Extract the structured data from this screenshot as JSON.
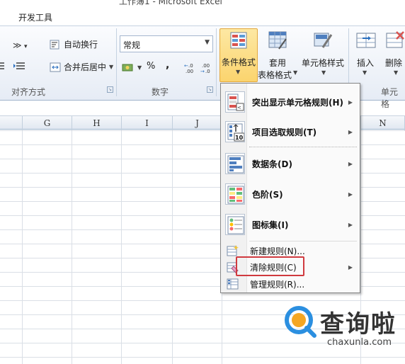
{
  "window": {
    "title": "工作簿1 - Microsoft Excel"
  },
  "tabs": {
    "developer": "开发工具"
  },
  "ribbon": {
    "alignment": {
      "label": "对齐方式",
      "wrap_text": "自动换行",
      "merge_center": "合并后居中"
    },
    "number": {
      "label": "数字",
      "format_value": "常规",
      "percent": "%",
      "comma": ",",
      "increase_decimal": ".00",
      "decrease_decimal": ".00"
    },
    "styles": {
      "conditional_formatting": "条件格式",
      "format_as_table_line1": "套用",
      "format_as_table_line2": "表格格式",
      "cell_styles": "单元格样式"
    },
    "cells": {
      "label": "单元格",
      "insert": "插入",
      "delete": "删除"
    }
  },
  "columns": [
    "G",
    "H",
    "I",
    "J",
    "N"
  ],
  "menu": {
    "items": [
      {
        "label": "突出显示单元格规则(H)",
        "icon": "highlight-rules-icon",
        "has_submenu": true
      },
      {
        "label": "项目选取规则(T)",
        "icon": "top-bottom-rules-icon",
        "has_submenu": true
      },
      {
        "label": "数据条(D)",
        "icon": "data-bars-icon",
        "has_submenu": true
      },
      {
        "label": "色阶(S)",
        "icon": "color-scales-icon",
        "has_submenu": true
      },
      {
        "label": "图标集(I)",
        "icon": "icon-sets-icon",
        "has_submenu": true
      },
      {
        "label": "新建规则(N)...",
        "icon": "new-rule-icon",
        "has_submenu": false
      },
      {
        "label": "清除规则(C)",
        "icon": "clear-rules-icon",
        "has_submenu": true,
        "highlighted": true
      },
      {
        "label": "管理规则(R)...",
        "icon": "manage-rules-icon",
        "has_submenu": false
      }
    ]
  },
  "watermark": {
    "brand": "查询啦",
    "url": "chaxunla.com"
  },
  "colors": {
    "highlight_box": "#d03a3f",
    "active_button": "#fbd46e",
    "ribbon_bg": "#e6ecf5"
  }
}
